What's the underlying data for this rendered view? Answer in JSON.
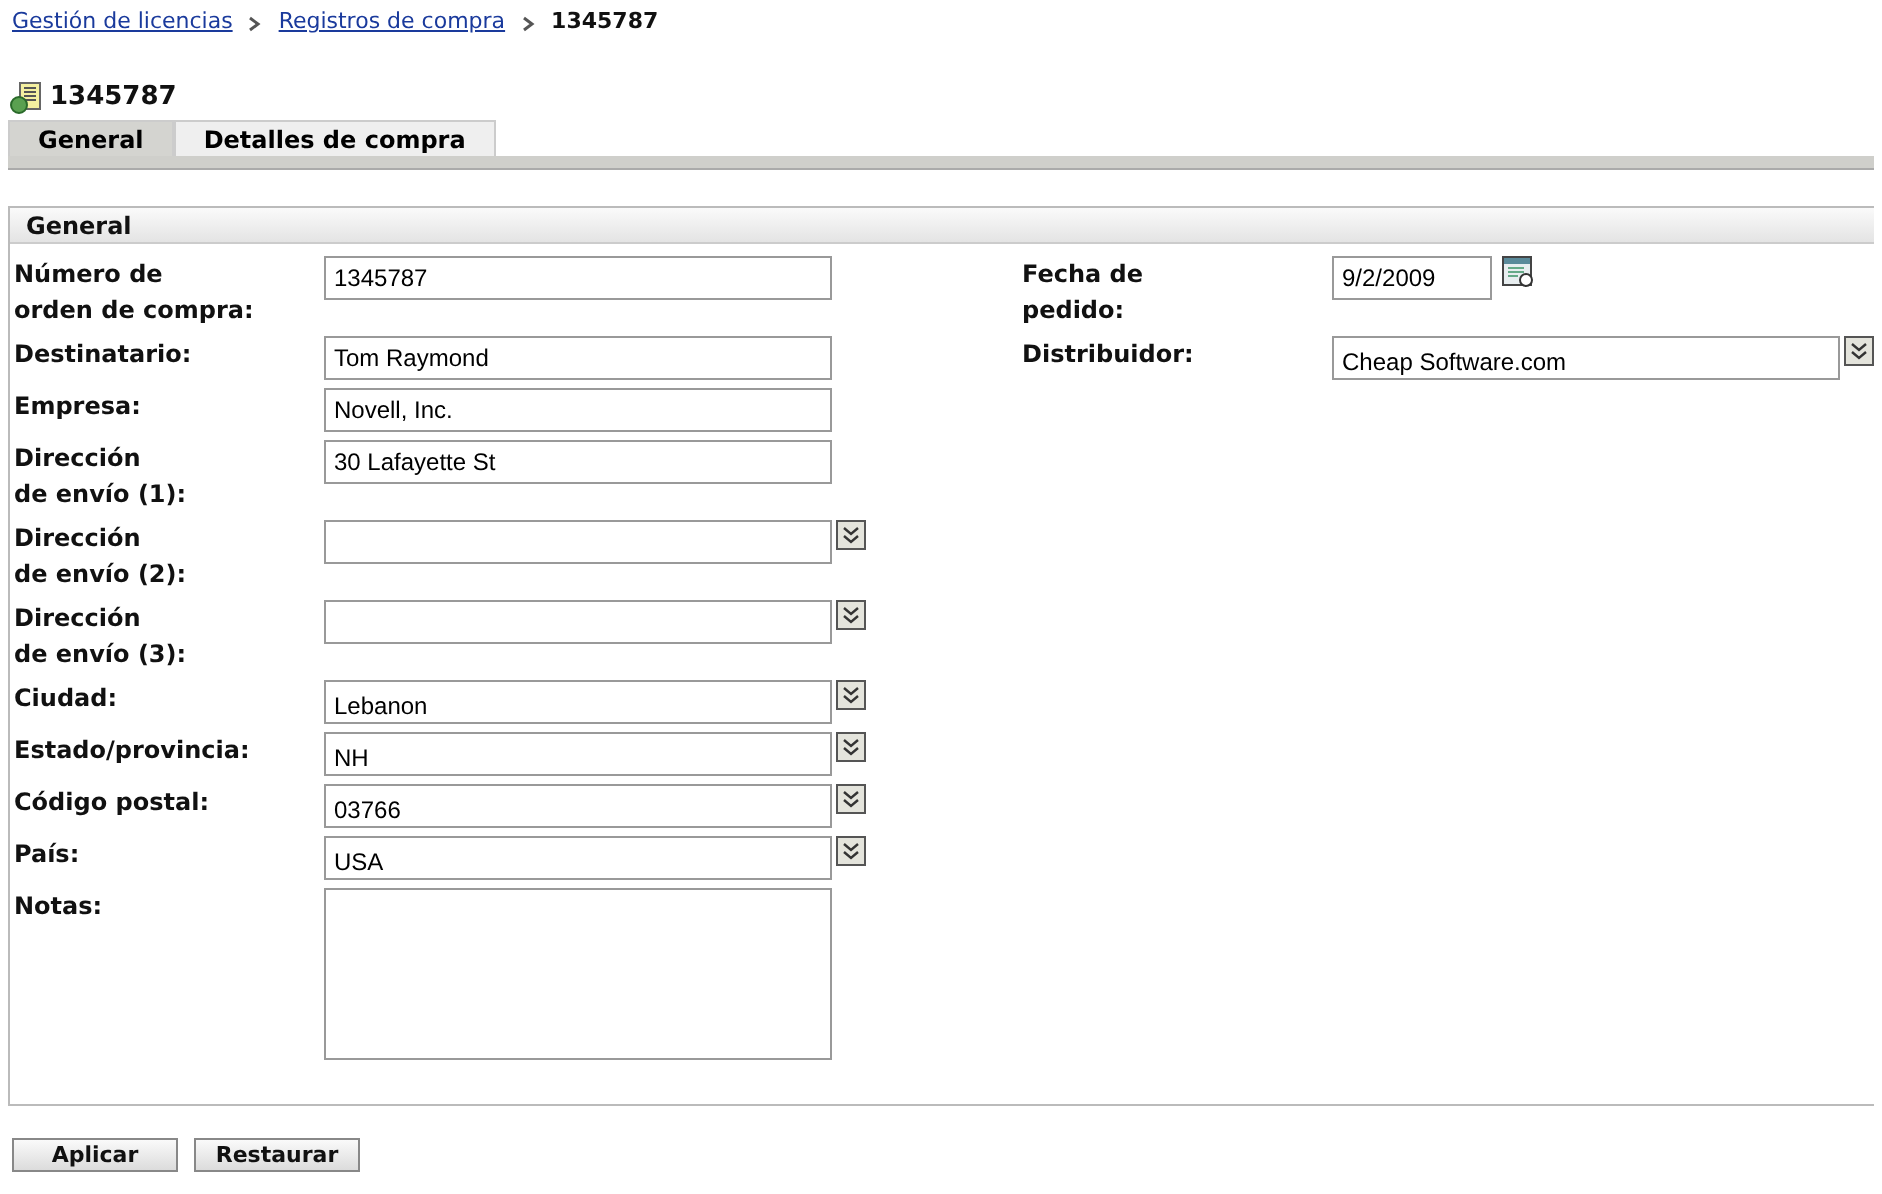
{
  "breadcrumb": [
    {
      "label": "Gestión de licencias",
      "link": true
    },
    {
      "label": "Registros de compra",
      "link": true
    },
    {
      "label": "1345787",
      "link": false
    }
  ],
  "title": "1345787",
  "tabs": [
    {
      "label": "General",
      "selected": true
    },
    {
      "label": "Detalles de compra",
      "selected": false
    }
  ],
  "section": {
    "title": "General",
    "left_fields": [
      {
        "label": "Número de\norden de compra:",
        "kind": "text",
        "value": "1345787"
      },
      {
        "label": "Destinatario:",
        "kind": "text",
        "value": "Tom Raymond"
      },
      {
        "label": "Empresa:",
        "kind": "text",
        "value": "Novell, Inc."
      },
      {
        "label": "Dirección\nde envío (1):",
        "kind": "text",
        "value": "30 Lafayette St"
      },
      {
        "label": "Dirección\nde envío (2):",
        "kind": "combo"
      },
      {
        "label": "Dirección\nde envío (3):",
        "kind": "combo"
      },
      {
        "label": "Ciudad:",
        "kind": "combo",
        "value": "Lebanon"
      },
      {
        "label": "Estado/provincia:",
        "kind": "combo",
        "value": "NH"
      },
      {
        "label": "Código postal:",
        "kind": "combo",
        "value": "03766"
      },
      {
        "label": "País:",
        "kind": "combo",
        "value": "USA"
      },
      {
        "label": "Notas:",
        "kind": "textarea"
      }
    ],
    "right_fields": [
      {
        "label": "Fecha de\npedido:",
        "kind": "date",
        "value": "9/2/2009"
      },
      {
        "label": "Distribuidor:",
        "kind": "combo",
        "value": "Cheap Software.com"
      }
    ]
  },
  "buttons": [
    "Aplicar",
    "Restaurar"
  ]
}
